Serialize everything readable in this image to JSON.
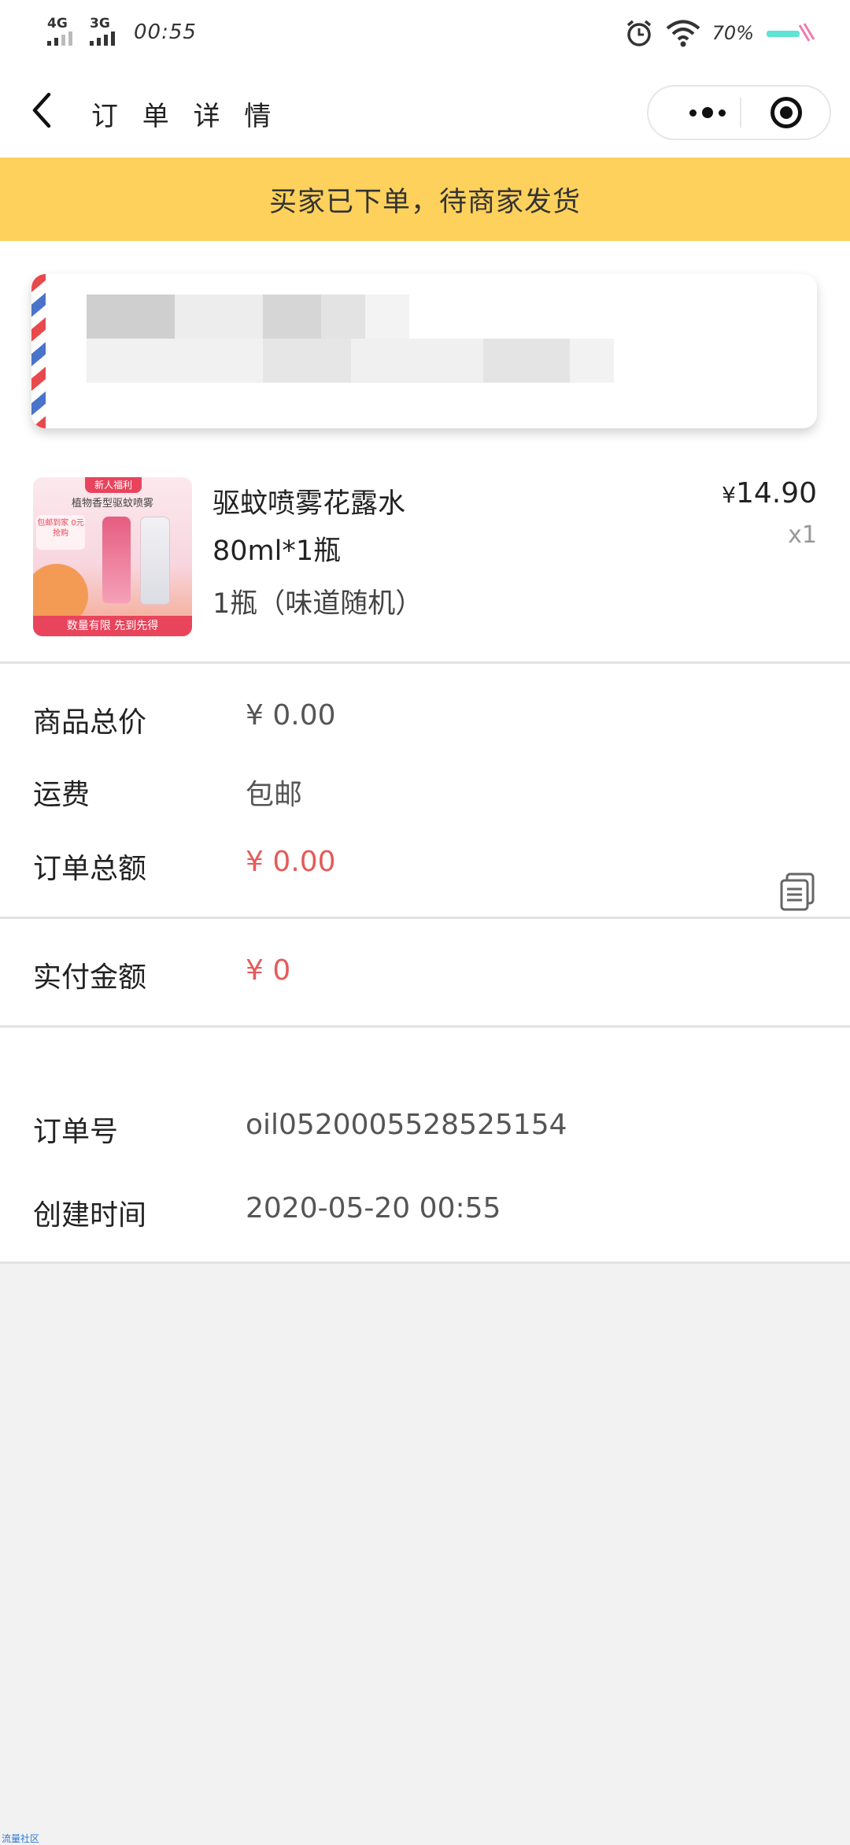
{
  "status_bar": {
    "network_1": "4G",
    "network_2": "3G",
    "time": "00:55",
    "battery": "70%",
    "icons": [
      "alarm-icon",
      "wifi-icon",
      "battery-icon"
    ]
  },
  "nav": {
    "title": "订 单 详 情",
    "icons": [
      "back-arrow-icon",
      "more-icon",
      "close-mini-program-icon"
    ]
  },
  "banner": {
    "text": "买家已下单，待商家发货"
  },
  "product": {
    "image_texts": {
      "tag": "新人福利",
      "subtitle": "植物香型驱蚊喷雾",
      "badge": "包邮到家 0元抢购",
      "footer": "数量有限 先到先得"
    },
    "name": "驱蚊喷雾花露水80ml*1瓶",
    "spec": "1瓶（味道随机）",
    "price_symbol": "¥",
    "price": "14.90",
    "quantity": "x1"
  },
  "summary": {
    "goods_total_label": "商品总价",
    "goods_total_value": "¥ 0.00",
    "shipping_label": "运费",
    "shipping_value": "包邮",
    "order_total_label": "订单总额",
    "order_total_value": "¥ 0.00",
    "paid_label": "实付金额",
    "paid_value": "¥ 0"
  },
  "order_info": {
    "order_no_label": "订单号",
    "order_no_value": "oil0520005528525154",
    "created_label": "创建时间",
    "created_value": "2020-05-20 00:55"
  },
  "colors": {
    "banner": "#fdd15b",
    "accent_red": "#e45b5b",
    "background": "#f2f2f2"
  },
  "watermark": "流量社区"
}
